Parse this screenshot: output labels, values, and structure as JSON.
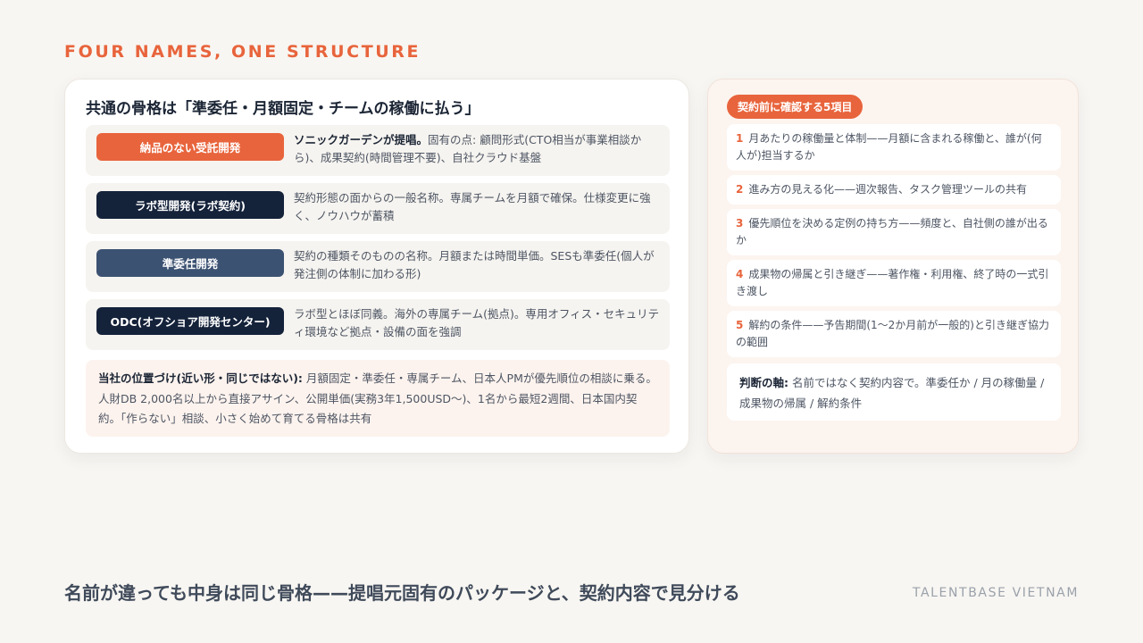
{
  "header": {
    "kicker": "FOUR NAMES, ONE STRUCTURE"
  },
  "left": {
    "title": "共通の骨格は「準委任・月額固定・チームの稼働に払う」",
    "rows": [
      {
        "label": "納品のない受託開発",
        "color": "#e8643c",
        "lead": "ソニックガーデンが提唱。",
        "text": "固有の点: 顧問形式(CTO相当が事業相談から)、成果契約(時間管理不要)、自社クラウド基盤"
      },
      {
        "label": "ラボ型開発(ラボ契約)",
        "color": "#14223a",
        "lead": "",
        "text": "契約形態の面からの一般名称。専属チームを月額で確保。仕様変更に強く、ノウハウが蓄積"
      },
      {
        "label": "準委任開発",
        "color": "#3c5272",
        "lead": "",
        "text": "契約の種類そのものの名称。月額または時間単価。SESも準委任(個人が発注側の体制に加わる形)"
      },
      {
        "label": "ODC(オフショア開発センター)",
        "color": "#14223a",
        "lead": "",
        "text": "ラボ型とほぼ同義。海外の専属チーム(拠点)。専用オフィス・セキュリティ環境など拠点・設備の面を強調"
      }
    ],
    "note": {
      "lead": "当社の位置づけ(近い形・同じではない):",
      "text": " 月額固定・準委任・専属チーム、日本人PMが優先順位の相談に乗る。人財DB 2,000名以上から直接アサイン、公開単価(実務3年1,500USD〜)、1名から最短2週間、日本国内契約。「作らない」相談、小さく始めて育てる骨格は共有"
    }
  },
  "right": {
    "badge": "契約前に確認する5項目",
    "items": [
      {
        "num": "1",
        "text": "月あたりの稼働量と体制——月額に含まれる稼働と、誰が(何人が)担当するか"
      },
      {
        "num": "2",
        "text": "進み方の見える化——週次報告、タスク管理ツールの共有"
      },
      {
        "num": "3",
        "text": "優先順位を決める定例の持ち方——頻度と、自社側の誰が出るか"
      },
      {
        "num": "4",
        "text": "成果物の帰属と引き継ぎ——著作権・利用権、終了時の一式引き渡し"
      },
      {
        "num": "5",
        "text": "解約の条件——予告期間(1〜2か月前が一般的)と引き継ぎ協力の範囲"
      }
    ],
    "axis": {
      "lead": "判断の軸:",
      "text": " 名前ではなく契約内容で。準委任か / 月の稼働量 / 成果物の帰属 / 解約条件"
    }
  },
  "footer": {
    "title": "名前が違っても中身は同じ骨格——提唱元固有のパッケージと、契約内容で見分ける",
    "brand": "TALENTBASE VIETNAM"
  }
}
